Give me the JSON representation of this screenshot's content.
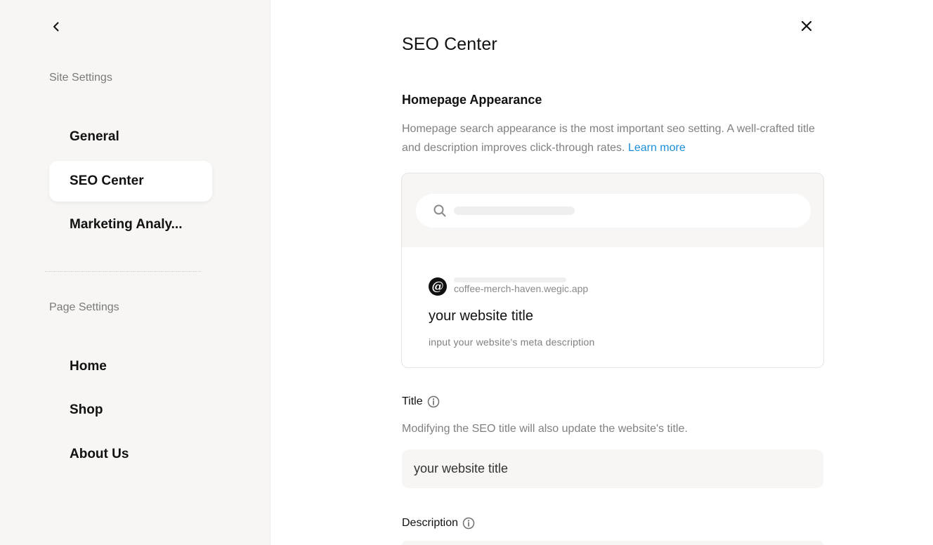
{
  "sidebar": {
    "site_settings_label": "Site Settings",
    "site_items": [
      {
        "label": "General"
      },
      {
        "label": "SEO Center"
      },
      {
        "label": "Marketing Analy..."
      }
    ],
    "page_settings_label": "Page Settings",
    "page_items": [
      {
        "label": "Home"
      },
      {
        "label": "Shop"
      },
      {
        "label": "About Us"
      }
    ],
    "active_item": "SEO Center"
  },
  "main": {
    "title": "SEO Center",
    "homepage_appearance": {
      "heading": "Homepage Appearance",
      "description": "Homepage search appearance is the most important seo setting. A well-crafted title and description improves click-through rates.",
      "learn_more": "Learn more"
    },
    "preview": {
      "url": "coffee-merch-haven.wegic.app",
      "title": "your website title",
      "description": "input your website's meta description"
    },
    "title_field": {
      "label": "Title",
      "hint": "Modifying the SEO title will also update the website's title.",
      "value": "your website title"
    },
    "description_field": {
      "label": "Description"
    }
  },
  "icons": {
    "back": "chevron-left-icon",
    "close": "close-icon",
    "search": "search-icon",
    "info": "info-icon",
    "logo": "wegic-logo-icon"
  },
  "colors": {
    "sidebar_bg": "#f7f6f4",
    "link": "#1a8fd8",
    "muted_text": "#808080"
  }
}
